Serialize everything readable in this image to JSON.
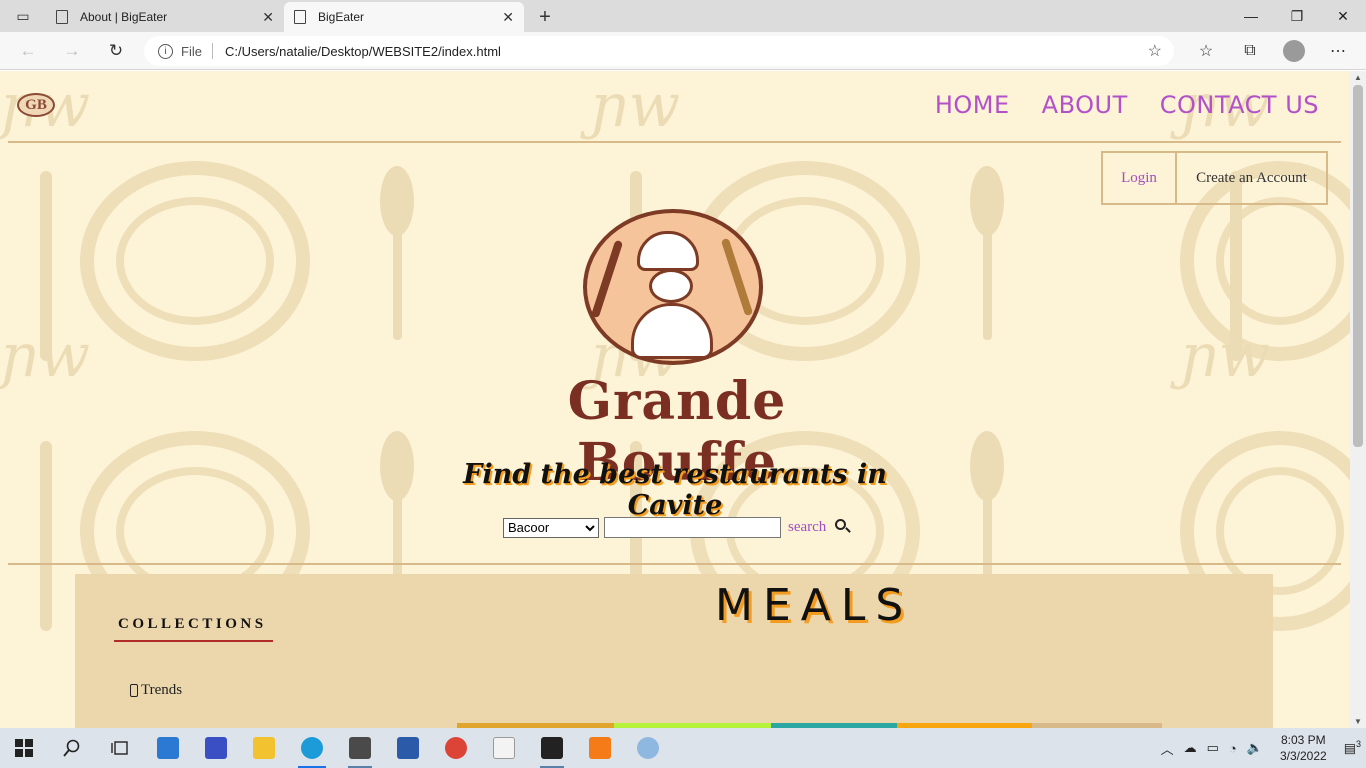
{
  "browser": {
    "tabs": [
      {
        "title": "About | BigEater",
        "active": false
      },
      {
        "title": "BigEater",
        "active": true
      }
    ],
    "address": {
      "scheme_label": "File",
      "url": "C:/Users/natalie/Desktop/WEBSITE2/index.html"
    }
  },
  "page": {
    "logo_text": "GB",
    "nav": [
      "HOME",
      "ABOUT",
      "CONTACT US"
    ],
    "auth": {
      "login": "Login",
      "create": "Create an Account"
    },
    "brand_name": "Grande Bouffe",
    "tagline": "Find the best restaurants in Cavite",
    "search": {
      "location_selected": "Bacoor",
      "query_value": "",
      "button_label": "search"
    },
    "meals_title": "MEALS",
    "sidebar_heading": "COLLECTIONS",
    "sidebar_items": [
      "Trends"
    ],
    "colors": {
      "nav_link": "#b251c9",
      "background": "#fdf3d6",
      "panel": "#ecd7ad",
      "accent_orange": "#f39c1f",
      "brand_brown": "#7b2e22",
      "colorbar": [
        "#e0a52c",
        "#b6f23c",
        "#2aa7a2",
        "#f9a50f",
        "#d8b98a"
      ]
    }
  },
  "taskbar": {
    "time": "8:03 PM",
    "date": "3/3/2022",
    "notification_count": "3"
  }
}
